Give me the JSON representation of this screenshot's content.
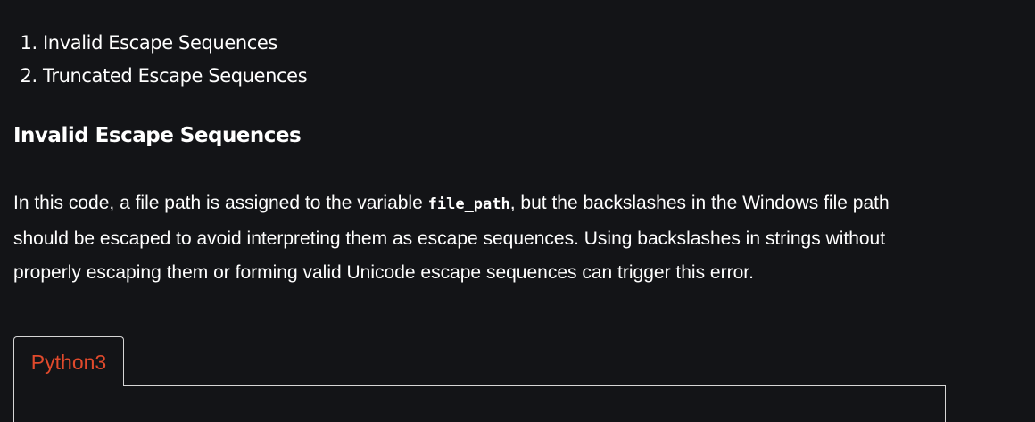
{
  "toc": {
    "items": [
      "Invalid Escape Sequences",
      "Truncated Escape Sequences"
    ]
  },
  "section": {
    "heading": "Invalid Escape Sequences",
    "paragraph_before_code": "In this code, a file path is assigned to the variable ",
    "inline_code": "file_path",
    "paragraph_after_code": ", but the backslashes in the Windows file path should be escaped to avoid interpreting them as escape sequences. Using backslashes in strings without properly escaping them or forming valid Unicode escape sequences can trigger this error."
  },
  "code_block": {
    "language_tab": "Python3"
  },
  "colors": {
    "background": "#131417",
    "text": "#ffffff",
    "tab_accent": "#e14a2c",
    "border": "#d6d6d6"
  }
}
